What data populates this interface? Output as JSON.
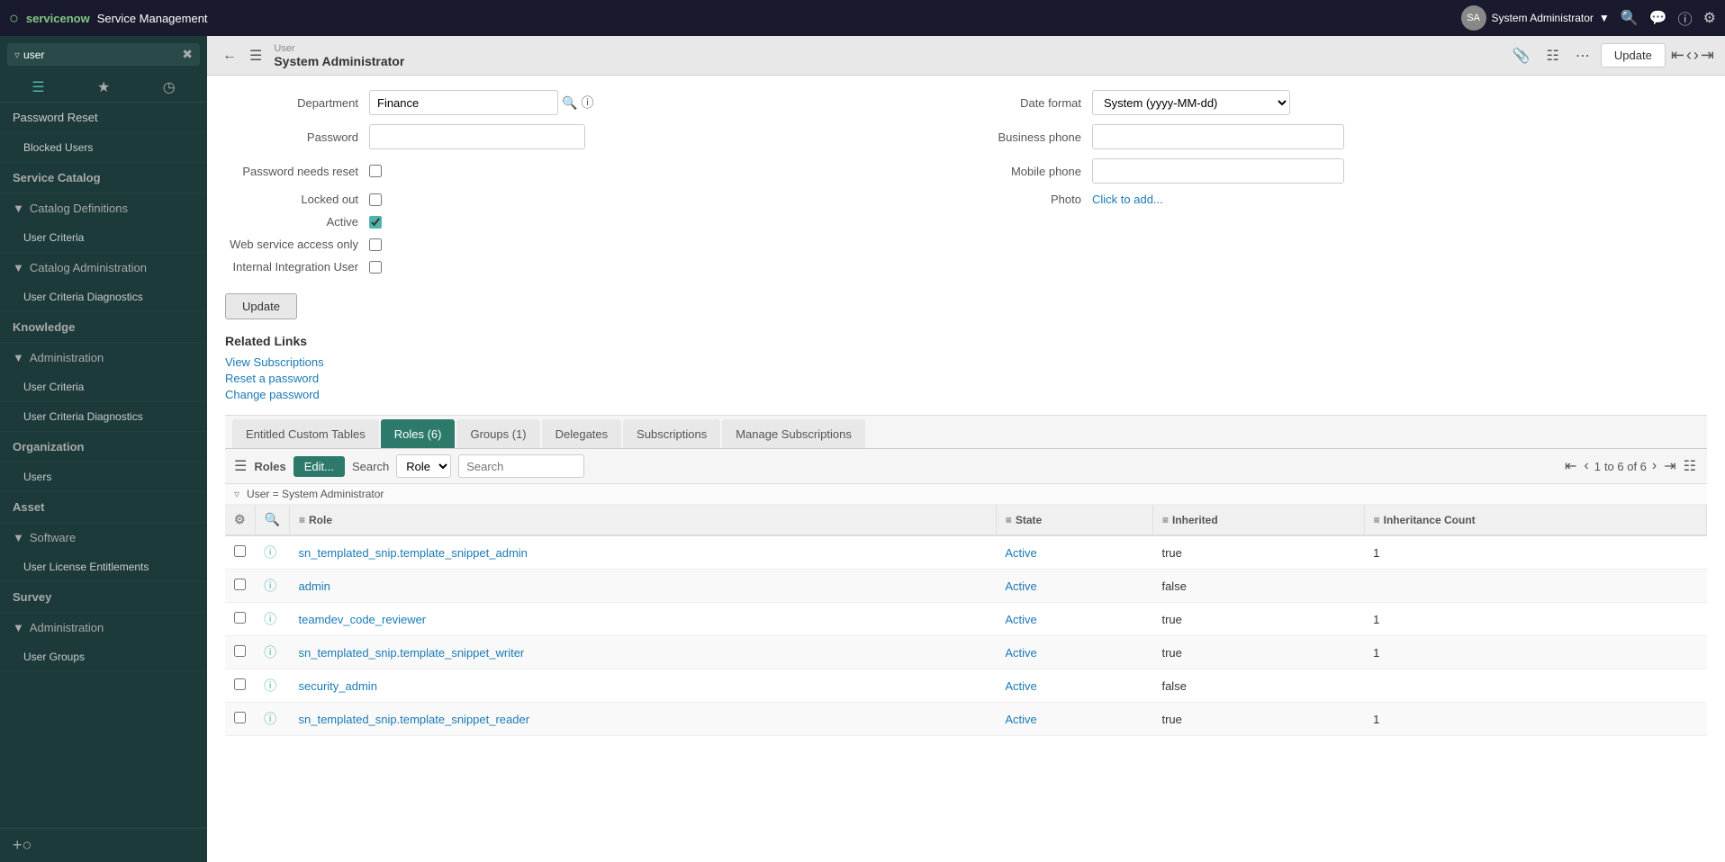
{
  "navbar": {
    "logo": "servicenow",
    "app": "Service Management",
    "user": "System Administrator",
    "icons": [
      "search",
      "chat",
      "help",
      "settings"
    ]
  },
  "sidebar": {
    "search_placeholder": "user",
    "items": [
      {
        "id": "password-reset",
        "label": "Password Reset",
        "level": 0
      },
      {
        "id": "blocked-users",
        "label": "Blocked Users",
        "level": 1
      },
      {
        "id": "service-catalog",
        "label": "Service Catalog",
        "level": 0,
        "type": "section"
      },
      {
        "id": "catalog-definitions",
        "label": "▼ Catalog Definitions",
        "level": 0
      },
      {
        "id": "user-criteria",
        "label": "User Criteria",
        "level": 1
      },
      {
        "id": "catalog-administration",
        "label": "▼ Catalog Administration",
        "level": 0
      },
      {
        "id": "user-criteria-diagnostics-1",
        "label": "User Criteria Diagnostics",
        "level": 1
      },
      {
        "id": "knowledge",
        "label": "Knowledge",
        "level": 0,
        "type": "section"
      },
      {
        "id": "administration",
        "label": "▼ Administration",
        "level": 0
      },
      {
        "id": "user-criteria-2",
        "label": "User Criteria",
        "level": 1
      },
      {
        "id": "user-criteria-diagnostics-2",
        "label": "User Criteria Diagnostics",
        "level": 1
      },
      {
        "id": "organization",
        "label": "Organization",
        "level": 0,
        "type": "section"
      },
      {
        "id": "users",
        "label": "Users",
        "level": 1
      },
      {
        "id": "asset",
        "label": "Asset",
        "level": 0,
        "type": "section"
      },
      {
        "id": "software",
        "label": "▼ Software",
        "level": 0
      },
      {
        "id": "user-license",
        "label": "User License Entitlements",
        "level": 1
      },
      {
        "id": "survey",
        "label": "Survey",
        "level": 0,
        "type": "section"
      },
      {
        "id": "administration2",
        "label": "▼ Administration",
        "level": 0
      },
      {
        "id": "user-groups",
        "label": "User Groups",
        "level": 1
      }
    ]
  },
  "record": {
    "breadcrumb_top": "User",
    "breadcrumb_main": "System Administrator",
    "dept_value": "Finance",
    "date_format_value": "System (yyyy-MM-dd)",
    "photo_label": "Click to add...",
    "password_placeholder": "",
    "business_phone_placeholder": "",
    "mobile_phone_placeholder": "",
    "fields": {
      "department": "Department",
      "password": "Password",
      "password_needs_reset": "Password needs reset",
      "locked_out": "Locked out",
      "active": "Active",
      "web_service_access_only": "Web service access only",
      "internal_integration_user": "Internal Integration User",
      "date_format": "Date format",
      "business_phone": "Business phone",
      "mobile_phone": "Mobile phone",
      "photo": "Photo"
    }
  },
  "related_links": {
    "title": "Related Links",
    "links": [
      "View Subscriptions",
      "Reset a password",
      "Change password"
    ]
  },
  "tabs": {
    "items": [
      {
        "id": "entitled-custom-tables",
        "label": "Entitled Custom Tables",
        "active": false
      },
      {
        "id": "roles",
        "label": "Roles (6)",
        "active": true
      },
      {
        "id": "groups",
        "label": "Groups (1)",
        "active": false
      },
      {
        "id": "delegates",
        "label": "Delegates",
        "active": false
      },
      {
        "id": "subscriptions",
        "label": "Subscriptions",
        "active": false
      },
      {
        "id": "manage-subscriptions",
        "label": "Manage Subscriptions",
        "active": false
      }
    ]
  },
  "table_toolbar": {
    "roles_label": "Roles",
    "edit_label": "Edit...",
    "search_label": "Search",
    "search_field_default": "Role",
    "search_placeholder": "Search",
    "page_current": "1",
    "page_total": "to 6 of 6"
  },
  "filter": {
    "text": "User = System Administrator"
  },
  "table": {
    "columns": [
      "Role",
      "State",
      "Inherited",
      "Inheritance Count"
    ],
    "rows": [
      {
        "role": "sn_templated_snip.template_snippet_admin",
        "state": "Active",
        "inherited": "true",
        "count": "1"
      },
      {
        "role": "admin",
        "state": "Active",
        "inherited": "false",
        "count": ""
      },
      {
        "role": "teamdev_code_reviewer",
        "state": "Active",
        "inherited": "true",
        "count": "1"
      },
      {
        "role": "sn_templated_snip.template_snippet_writer",
        "state": "Active",
        "inherited": "true",
        "count": "1"
      },
      {
        "role": "security_admin",
        "state": "Active",
        "inherited": "false",
        "count": ""
      },
      {
        "role": "sn_templated_snip.template_snippet_reader",
        "state": "Active",
        "inherited": "true",
        "count": "1"
      }
    ]
  },
  "buttons": {
    "update": "Update",
    "update_form": "Update"
  }
}
